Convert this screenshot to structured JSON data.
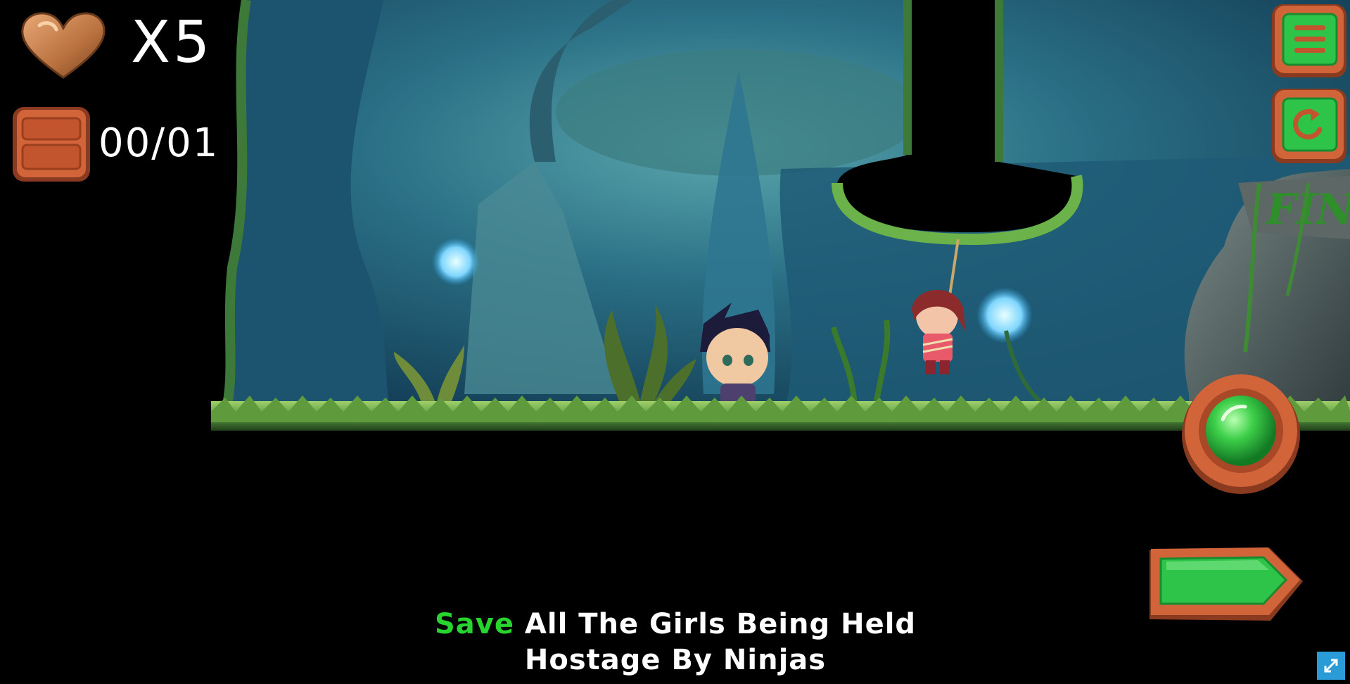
{
  "hud": {
    "lives_count": "X5",
    "rescue_counter": "00/01"
  },
  "scene": {
    "finish_sign_text": "FIN"
  },
  "instruction": {
    "highlight": "Save",
    "line1_rest": " All The Girls Being Held",
    "line2": "Hostage By Ninjas"
  },
  "icons": {
    "lives": "heart-icon",
    "crate": "crate-icon",
    "menu": "menu-icon",
    "restart": "restart-icon",
    "action": "green-orb-icon",
    "next": "arrow-right-icon",
    "fullscreen": "fullscreen-icon"
  },
  "colors": {
    "highlight": "#28d42e",
    "wood": "#c8582a",
    "button_green": "#2ec44a",
    "background_cave": "#1f5c73"
  }
}
